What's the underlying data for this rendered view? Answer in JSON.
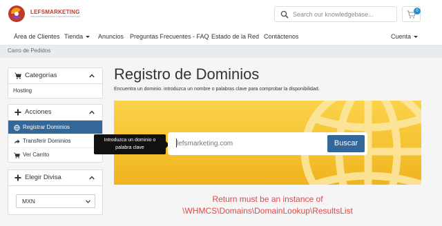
{
  "brand": {
    "logo_text": "LEFSMARKETING",
    "logo_subtext": "PARA EMPRENDEDORES & NEGOCIOS DIGITALES",
    "primary_color": "#336699",
    "accent_color": "#c0392b"
  },
  "header": {
    "search_placeholder": "Search our knowledgebase...",
    "cart_count": "0"
  },
  "nav": {
    "items": [
      {
        "label": "Área de Clientes"
      },
      {
        "label": "Tienda",
        "dropdown": true
      },
      {
        "label": "Anuncios"
      },
      {
        "label": "Preguntas Frecuentes - FAQ"
      },
      {
        "label": "Estado de la Red"
      },
      {
        "label": "Contáctenos"
      }
    ],
    "account": "Cuenta"
  },
  "breadcrumb": "Carro de Pedidos",
  "sidebar": {
    "categories": {
      "title": "Categorías",
      "items": [
        {
          "label": "Hosting"
        }
      ]
    },
    "actions": {
      "title": "Acciones",
      "items": [
        {
          "label": "Registrar Dominios",
          "icon": "globe-icon",
          "active": true
        },
        {
          "label": "Transferir Dominios",
          "icon": "share-icon",
          "active": false
        },
        {
          "label": "Ver Carrito",
          "icon": "cart-icon",
          "active": false
        }
      ]
    },
    "currency": {
      "title": "Elegir Divisa",
      "selected": "MXN"
    }
  },
  "main": {
    "title": "Registro de Dominios",
    "description": "Encuentra un dominio. introduzca un nombre o palabras clave para comprobar la disponibilidad.",
    "domain_placeholder": "lefsmarketing.com",
    "search_button": "Buscar",
    "tooltip_line1": "Introduzca un dominio o",
    "tooltip_line2": "palabra clave",
    "error_line1": "Return must be an instance of",
    "error_line2": "\\WHMCS\\Domains\\DomainLookup\\ResultsList",
    "hero_color": "#f5c02e",
    "error_color": "#e04848"
  }
}
